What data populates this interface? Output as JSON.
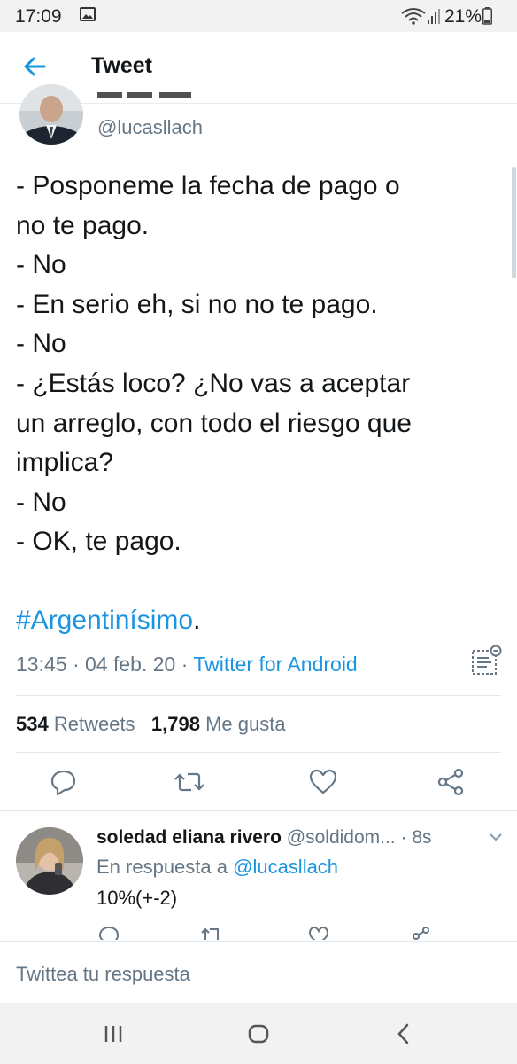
{
  "status_bar": {
    "time": "17:09",
    "battery": "21%"
  },
  "app_bar": {
    "title": "Tweet"
  },
  "tweet": {
    "handle": "@lucasllach",
    "lines": [
      "- Posponeme la fecha de pago o",
      "no te pago.",
      "- No",
      "- En serio eh, si no no te pago.",
      "- No",
      "- ¿Estás loco? ¿No vas a aceptar",
      "un arreglo, con todo el riesgo que",
      "implica?",
      "- No",
      "- OK, te pago."
    ],
    "hashtag": "#Argentinísimo",
    "hashtag_suffix": ".",
    "time": "13:45",
    "date": "04 feb. 20",
    "source": "Twitter for Android",
    "retweets_count": "534",
    "retweets_label": "Retweets",
    "likes_count": "1,798",
    "likes_label": "Me gusta"
  },
  "reply": {
    "name": "soledad eliana rivero",
    "handle": "@soldidom...",
    "age": "· 8s",
    "in_reply_prefix": "En respuesta a",
    "in_reply_mention": "@lucasllach",
    "text": "10%(+-2)"
  },
  "compose": {
    "placeholder": "Twittea tu respuesta"
  },
  "colors": {
    "accent": "#1b95e0",
    "text": "#14171a",
    "secondary": "#657786",
    "border": "#e1e8ed"
  },
  "icons": {
    "back": "arrow-left-icon",
    "reply": "reply-icon",
    "retweet": "retweet-icon",
    "like": "heart-icon",
    "share": "share-icon",
    "analytics": "analytics-icon",
    "chevron": "chevron-down-icon"
  }
}
